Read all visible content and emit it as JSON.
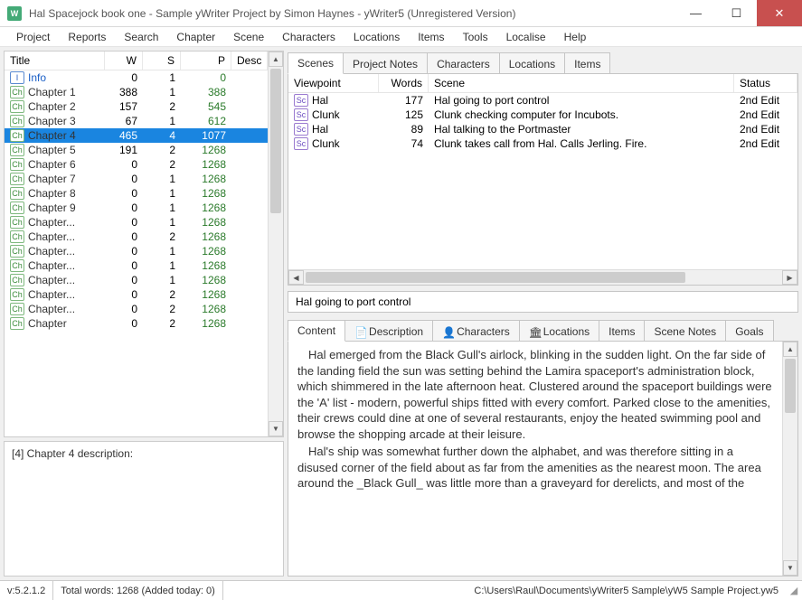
{
  "window": {
    "title": "Hal Spacejock book one - Sample yWriter Project by Simon Haynes - yWriter5 (Unregistered Version)"
  },
  "menu": [
    "Project",
    "Reports",
    "Search",
    "Chapter",
    "Scene",
    "Characters",
    "Locations",
    "Items",
    "Tools",
    "Localise",
    "Help"
  ],
  "chapters": {
    "headers": {
      "title": "Title",
      "w": "W",
      "s": "S",
      "p": "P",
      "desc": "Desc"
    },
    "rows": [
      {
        "icon": "info",
        "title": "Info",
        "w": "0",
        "s": "1",
        "p": "0",
        "info": true
      },
      {
        "icon": "ch",
        "title": "Chapter 1",
        "w": "388",
        "s": "1",
        "p": "388"
      },
      {
        "icon": "ch",
        "title": "Chapter 2",
        "w": "157",
        "s": "2",
        "p": "545"
      },
      {
        "icon": "ch",
        "title": "Chapter 3",
        "w": "67",
        "s": "1",
        "p": "612"
      },
      {
        "icon": "ch",
        "title": "Chapter 4",
        "w": "465",
        "s": "4",
        "p": "1077",
        "selected": true
      },
      {
        "icon": "ch",
        "title": "Chapter 5",
        "w": "191",
        "s": "2",
        "p": "1268"
      },
      {
        "icon": "ch",
        "title": "Chapter 6",
        "w": "0",
        "s": "2",
        "p": "1268"
      },
      {
        "icon": "ch",
        "title": "Chapter 7",
        "w": "0",
        "s": "1",
        "p": "1268"
      },
      {
        "icon": "ch",
        "title": "Chapter 8",
        "w": "0",
        "s": "1",
        "p": "1268"
      },
      {
        "icon": "ch",
        "title": "Chapter 9",
        "w": "0",
        "s": "1",
        "p": "1268"
      },
      {
        "icon": "ch",
        "title": "Chapter...",
        "w": "0",
        "s": "1",
        "p": "1268"
      },
      {
        "icon": "ch",
        "title": "Chapter...",
        "w": "0",
        "s": "2",
        "p": "1268"
      },
      {
        "icon": "ch",
        "title": "Chapter...",
        "w": "0",
        "s": "1",
        "p": "1268"
      },
      {
        "icon": "ch",
        "title": "Chapter...",
        "w": "0",
        "s": "1",
        "p": "1268"
      },
      {
        "icon": "ch",
        "title": "Chapter...",
        "w": "0",
        "s": "1",
        "p": "1268"
      },
      {
        "icon": "ch",
        "title": "Chapter...",
        "w": "0",
        "s": "2",
        "p": "1268"
      },
      {
        "icon": "ch",
        "title": "Chapter...",
        "w": "0",
        "s": "2",
        "p": "1268"
      },
      {
        "icon": "ch",
        "title": "Chapter",
        "w": "0",
        "s": "2",
        "p": "1268"
      }
    ]
  },
  "description": "[4] Chapter 4 description:",
  "right_tabs": [
    "Scenes",
    "Project Notes",
    "Characters",
    "Locations",
    "Items"
  ],
  "right_active_tab": 0,
  "scenes": {
    "headers": {
      "vp": "Viewpoint",
      "words": "Words",
      "scene": "Scene",
      "status": "Status"
    },
    "rows": [
      {
        "vp": "Hal",
        "words": "177",
        "scene": "Hal going to port control",
        "status": "2nd Edit"
      },
      {
        "vp": "Clunk",
        "words": "125",
        "scene": "Clunk checking computer for Incubots.",
        "status": "2nd Edit"
      },
      {
        "vp": "Hal",
        "words": "89",
        "scene": "Hal talking to the Portmaster",
        "status": "2nd Edit"
      },
      {
        "vp": "Clunk",
        "words": "74",
        "scene": "Clunk takes call from Hal. Calls Jerling. Fire.",
        "status": "2nd Edit"
      }
    ]
  },
  "scene_title": "Hal going to port control",
  "content_tabs": [
    "Content",
    "Description",
    "Characters",
    "Locations",
    "Items",
    "Scene Notes",
    "Goals"
  ],
  "content_active_tab": 0,
  "content_text": {
    "p1": "Hal emerged from the Black Gull's airlock, blinking in the sudden light. On the far side of the landing field the sun was setting behind the Lamira spaceport's administration block, which shimmered in the late afternoon heat. Clustered around the spaceport buildings were the 'A' list - modern, powerful ships fitted with every comfort. Parked close to the amenities, their crews could dine at one of several restaurants, enjoy the heated swimming pool and browse the shopping arcade at their leisure.",
    "p2": "Hal's ship was somewhat further down the alphabet, and was therefore sitting in a disused corner of the field about as far from the amenities as the nearest moon. The area around the _Black Gull_ was little more than a graveyard for derelicts, and most of the"
  },
  "status": {
    "version": "v:5.2.1.2",
    "totals": "Total words: 1268 (Added today: 0)",
    "path": "C:\\Users\\Raul\\Documents\\yWriter5 Sample\\yW5 Sample Project.yw5"
  }
}
